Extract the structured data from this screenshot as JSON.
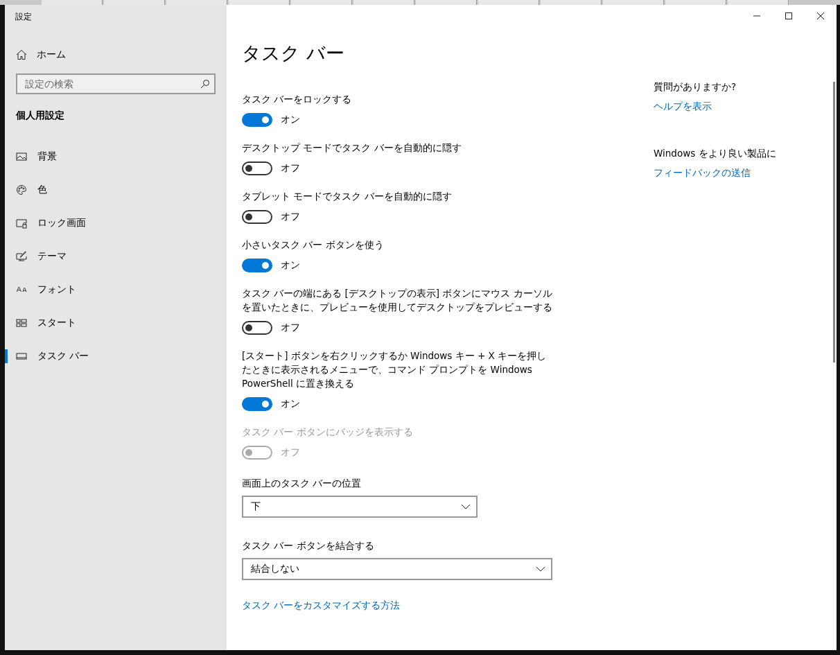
{
  "window": {
    "title": "設定"
  },
  "sidebar": {
    "home": "ホーム",
    "search": {
      "placeholder": "設定の検索"
    },
    "section": "個人用設定",
    "items": [
      {
        "label": "背景",
        "selected": false
      },
      {
        "label": "色",
        "selected": false
      },
      {
        "label": "ロック画面",
        "selected": false
      },
      {
        "label": "テーマ",
        "selected": false
      },
      {
        "label": "フォント",
        "selected": false
      },
      {
        "label": "スタート",
        "selected": false
      },
      {
        "label": "タスク バー",
        "selected": true
      }
    ]
  },
  "page": {
    "title": "タスク バー",
    "settings": [
      {
        "kind": "toggle",
        "label": "タスク バーをロックする",
        "on": true,
        "disabled": false,
        "state": "オン"
      },
      {
        "kind": "toggle",
        "label": "デスクトップ モードでタスク バーを自動的に隠す",
        "on": false,
        "disabled": false,
        "state": "オフ"
      },
      {
        "kind": "toggle",
        "label": "タブレット モードでタスク バーを自動的に隠す",
        "on": false,
        "disabled": false,
        "state": "オフ"
      },
      {
        "kind": "toggle",
        "label": "小さいタスク バー ボタンを使う",
        "on": true,
        "disabled": false,
        "state": "オン"
      },
      {
        "kind": "toggle",
        "label": "タスク バーの端にある [デスクトップの表示] ボタンにマウス カーソルを置いたときに、プレビューを使用してデスクトップをプレビューする",
        "on": false,
        "disabled": false,
        "state": "オフ"
      },
      {
        "kind": "toggle",
        "label": "[スタート] ボタンを右クリックするか Windows キー + X キーを押したときに表示されるメニューで、コマンド プロンプトを Windows PowerShell に置き換える",
        "on": true,
        "disabled": false,
        "state": "オン"
      },
      {
        "kind": "toggle",
        "label": "タスク バー ボタンにバッジを表示する",
        "on": false,
        "disabled": true,
        "state": "オフ"
      },
      {
        "kind": "dropdown",
        "label": "画面上のタスク バーの位置",
        "value": "下"
      },
      {
        "kind": "dropdown",
        "label": "タスク バー ボタンを結合する",
        "value": "結合しない"
      },
      {
        "kind": "link",
        "label": "タスク バーをカスタマイズする方法"
      }
    ]
  },
  "aside": [
    {
      "heading": "質問がありますか?",
      "link": "ヘルプを表示"
    },
    {
      "heading": "Windows をより良い製品に",
      "link": "フィードバックの送信"
    }
  ]
}
